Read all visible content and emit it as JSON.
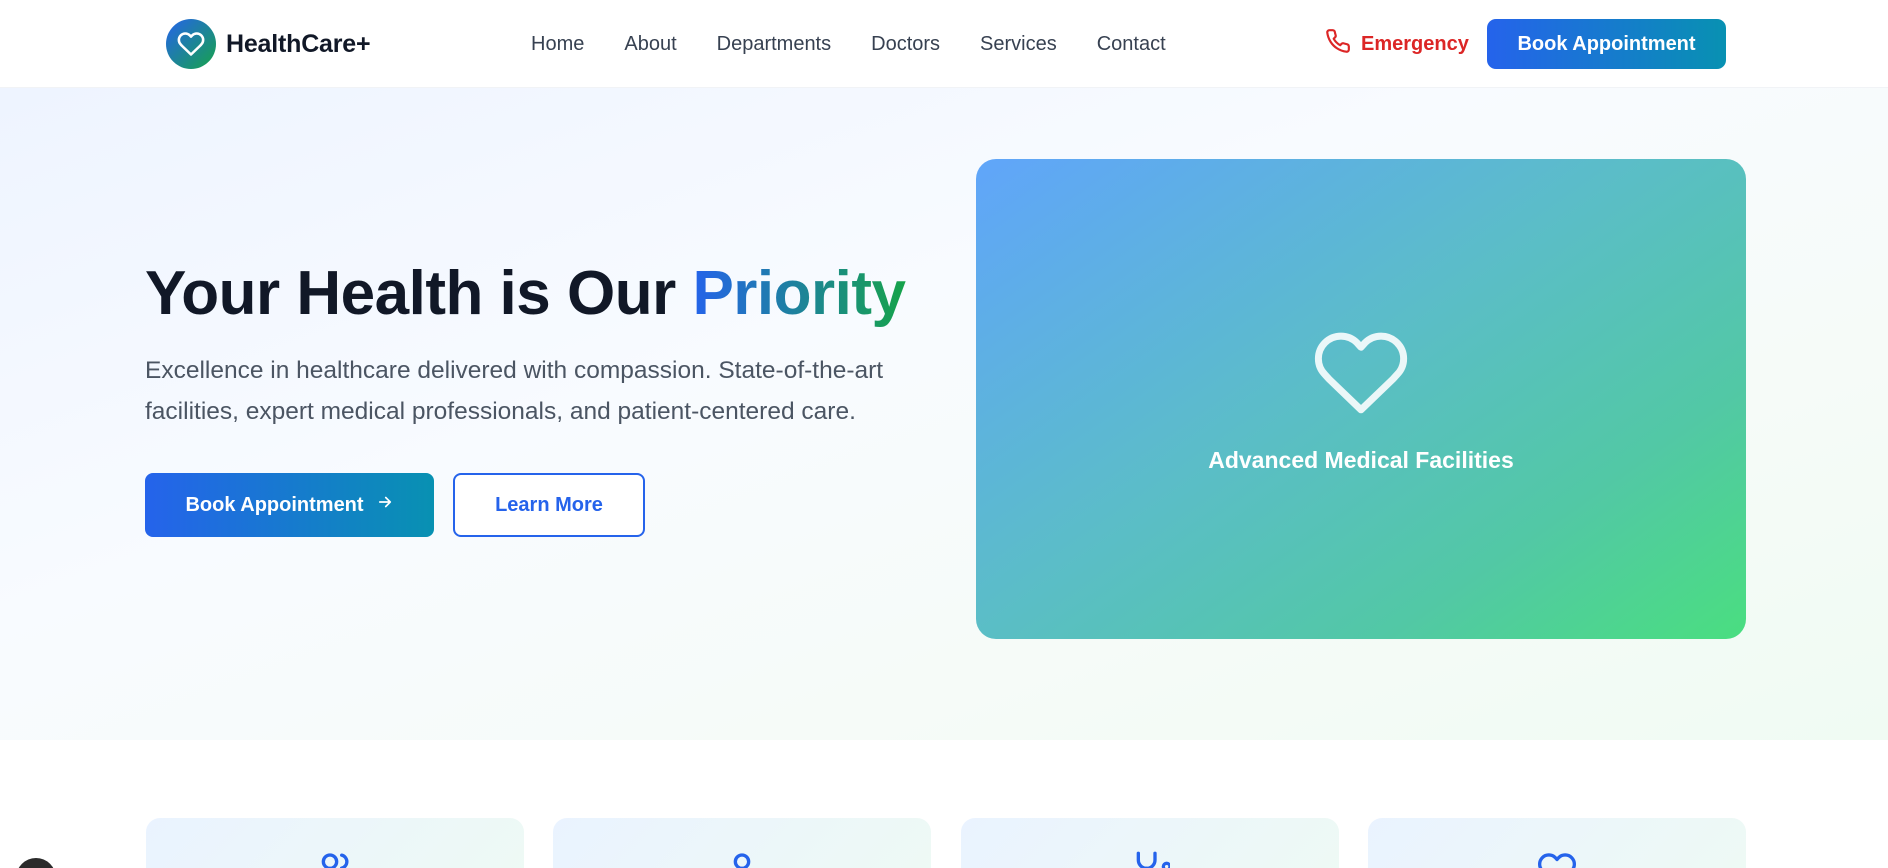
{
  "header": {
    "brand": "HealthCare+",
    "brand_icon": "heart-icon",
    "nav": [
      "Home",
      "About",
      "Departments",
      "Doctors",
      "Services",
      "Contact"
    ],
    "emergency_label": "Emergency",
    "emergency_icon": "phone-icon",
    "cta_label": "Book Appointment"
  },
  "hero": {
    "title_main": "Your Health is Our ",
    "title_accent": "Priority",
    "subtitle": "Excellence in healthcare delivered with compassion. State-of-the-art facilities, expert medical professionals, and patient-centered care.",
    "primary_button": "Book Appointment",
    "primary_button_icon": "arrow-right-icon",
    "secondary_button": "Learn More",
    "card": {
      "icon": "heart-icon",
      "label": "Advanced Medical Facilities"
    }
  },
  "features": [
    {
      "icon": "users-icon"
    },
    {
      "icon": "user-icon"
    },
    {
      "icon": "stethoscope-icon"
    },
    {
      "icon": "heart-icon"
    }
  ],
  "colors": {
    "primary": "#2563eb",
    "secondary": "#0891b2",
    "accent_green": "#16a34a",
    "emergency": "#dc2626",
    "text_dark": "#111827",
    "text_muted": "#4b5563"
  }
}
